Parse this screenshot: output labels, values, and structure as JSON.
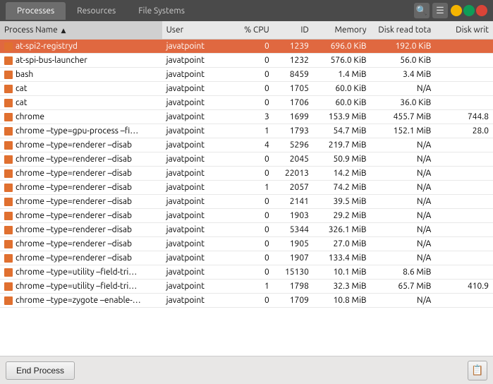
{
  "titlebar": {
    "tabs": [
      {
        "label": "Processes",
        "active": true
      },
      {
        "label": "Resources",
        "active": false
      },
      {
        "label": "File Systems",
        "active": false
      }
    ],
    "search_icon": "🔍",
    "menu_icon": "☰",
    "window_controls": {
      "min": "–",
      "max": "□",
      "close": "×"
    }
  },
  "table": {
    "columns": [
      {
        "label": "Process Name",
        "key": "name",
        "class": "col-name"
      },
      {
        "label": "User",
        "key": "user",
        "class": "col-user"
      },
      {
        "label": "% CPU",
        "key": "cpu",
        "class": "col-cpu num"
      },
      {
        "label": "ID",
        "key": "id",
        "class": "col-id num"
      },
      {
        "label": "Memory",
        "key": "mem",
        "class": "col-mem num"
      },
      {
        "label": "Disk read tota",
        "key": "diskr",
        "class": "col-diskr num"
      },
      {
        "label": "Disk writ",
        "key": "diskw",
        "class": "col-diskw num"
      }
    ],
    "rows": [
      {
        "name": "at-spi2-registryd",
        "user": "javatpoint",
        "cpu": "0",
        "id": "1239",
        "mem": "696.0 KiB",
        "diskr": "192.0 KiB",
        "diskw": "",
        "selected": true
      },
      {
        "name": "at-spi-bus-launcher",
        "user": "javatpoint",
        "cpu": "0",
        "id": "1232",
        "mem": "576.0 KiB",
        "diskr": "56.0 KiB",
        "diskw": ""
      },
      {
        "name": "bash",
        "user": "javatpoint",
        "cpu": "0",
        "id": "8459",
        "mem": "1.4 MiB",
        "diskr": "3.4 MiB",
        "diskw": ""
      },
      {
        "name": "cat",
        "user": "javatpoint",
        "cpu": "0",
        "id": "1705",
        "mem": "60.0 KiB",
        "diskr": "N/A",
        "diskw": ""
      },
      {
        "name": "cat",
        "user": "javatpoint",
        "cpu": "0",
        "id": "1706",
        "mem": "60.0 KiB",
        "diskr": "36.0 KiB",
        "diskw": ""
      },
      {
        "name": "chrome",
        "user": "javatpoint",
        "cpu": "3",
        "id": "1699",
        "mem": "153.9 MiB",
        "diskr": "455.7 MiB",
        "diskw": "744.8"
      },
      {
        "name": "chrome –type=gpu-process –fi…",
        "user": "javatpoint",
        "cpu": "1",
        "id": "1793",
        "mem": "54.7 MiB",
        "diskr": "152.1 MiB",
        "diskw": "28.0"
      },
      {
        "name": "chrome –type=renderer –disab",
        "user": "javatpoint",
        "cpu": "4",
        "id": "5296",
        "mem": "219.7 MiB",
        "diskr": "N/A",
        "diskw": ""
      },
      {
        "name": "chrome –type=renderer –disab",
        "user": "javatpoint",
        "cpu": "0",
        "id": "2045",
        "mem": "50.9 MiB",
        "diskr": "N/A",
        "diskw": ""
      },
      {
        "name": "chrome –type=renderer –disab",
        "user": "javatpoint",
        "cpu": "0",
        "id": "22013",
        "mem": "14.2 MiB",
        "diskr": "N/A",
        "diskw": ""
      },
      {
        "name": "chrome –type=renderer –disab",
        "user": "javatpoint",
        "cpu": "1",
        "id": "2057",
        "mem": "74.2 MiB",
        "diskr": "N/A",
        "diskw": ""
      },
      {
        "name": "chrome –type=renderer –disab",
        "user": "javatpoint",
        "cpu": "0",
        "id": "2141",
        "mem": "39.5 MiB",
        "diskr": "N/A",
        "diskw": ""
      },
      {
        "name": "chrome –type=renderer –disab",
        "user": "javatpoint",
        "cpu": "0",
        "id": "1903",
        "mem": "29.2 MiB",
        "diskr": "N/A",
        "diskw": ""
      },
      {
        "name": "chrome –type=renderer –disab",
        "user": "javatpoint",
        "cpu": "0",
        "id": "5344",
        "mem": "326.1 MiB",
        "diskr": "N/A",
        "diskw": ""
      },
      {
        "name": "chrome –type=renderer –disab",
        "user": "javatpoint",
        "cpu": "0",
        "id": "1905",
        "mem": "27.0 MiB",
        "diskr": "N/A",
        "diskw": ""
      },
      {
        "name": "chrome –type=renderer –disab",
        "user": "javatpoint",
        "cpu": "0",
        "id": "1907",
        "mem": "133.4 MiB",
        "diskr": "N/A",
        "diskw": ""
      },
      {
        "name": "chrome –type=utility –field-tri…",
        "user": "javatpoint",
        "cpu": "0",
        "id": "15130",
        "mem": "10.1 MiB",
        "diskr": "8.6 MiB",
        "diskw": ""
      },
      {
        "name": "chrome –type=utility –field-tri…",
        "user": "javatpoint",
        "cpu": "1",
        "id": "1798",
        "mem": "32.3 MiB",
        "diskr": "65.7 MiB",
        "diskw": "410.9"
      },
      {
        "name": "chrome –type=zygote –enable-…",
        "user": "javatpoint",
        "cpu": "0",
        "id": "1709",
        "mem": "10.8 MiB",
        "diskr": "N/A",
        "diskw": ""
      }
    ]
  },
  "bottombar": {
    "end_process_label": "End Process",
    "properties_icon": "📋"
  }
}
